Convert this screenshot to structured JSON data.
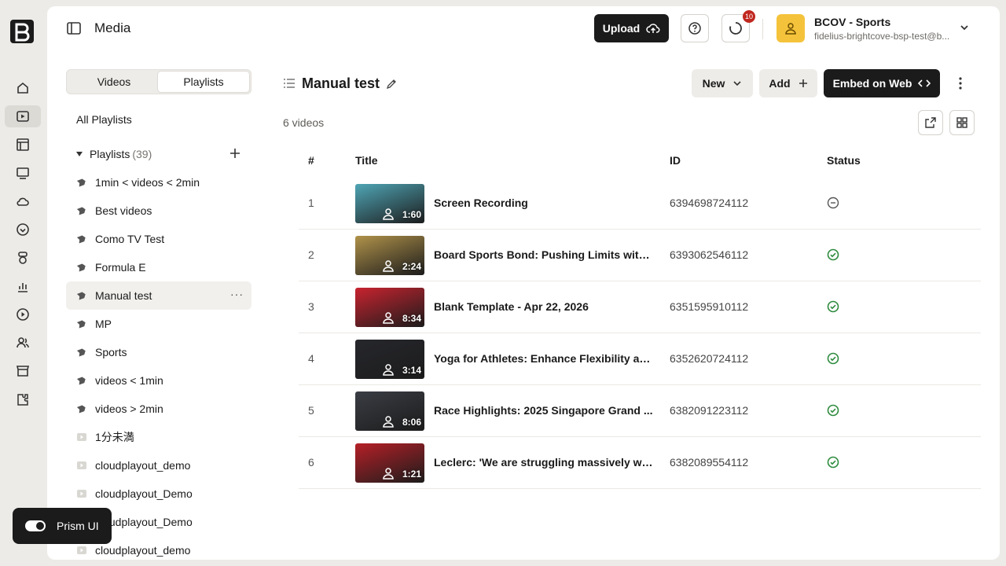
{
  "header": {
    "page_title": "Media",
    "upload_label": "Upload",
    "notification_count": "10",
    "account_name": "BCOV - Sports",
    "account_email": "fidelius-brightcove-bsp-test@b..."
  },
  "sidebar": {
    "tabs": [
      "Videos",
      "Playlists"
    ],
    "active_tab": "Playlists",
    "all_playlists": "All Playlists",
    "section_label": "Playlists",
    "section_count": "(39)",
    "items": [
      {
        "label": "1min < videos < 2min",
        "kind": "smart"
      },
      {
        "label": "Best videos",
        "kind": "smart"
      },
      {
        "label": "Como TV Test",
        "kind": "smart"
      },
      {
        "label": "Formula E",
        "kind": "smart"
      },
      {
        "label": "Manual test",
        "kind": "smart"
      },
      {
        "label": "MP",
        "kind": "smart"
      },
      {
        "label": "Sports",
        "kind": "smart"
      },
      {
        "label": "videos < 1min",
        "kind": "smart"
      },
      {
        "label": "videos > 2min",
        "kind": "smart"
      },
      {
        "label": "1分未満",
        "kind": "manual"
      },
      {
        "label": "cloudplayout_demo",
        "kind": "manual"
      },
      {
        "label": "cloudplayout_Demo",
        "kind": "manual"
      },
      {
        "label": "cloudplayout_Demo",
        "kind": "manual"
      },
      {
        "label": "cloudplayout_demo",
        "kind": "manual"
      }
    ],
    "selected_item": "Manual test",
    "more_glyph": "···"
  },
  "prism": {
    "label": "Prism UI",
    "enabled": true
  },
  "content": {
    "playlist_title": "Manual test",
    "video_count": "6 videos",
    "new_label": "New",
    "add_label": "Add",
    "embed_label": "Embed on Web",
    "columns": {
      "num": "#",
      "title": "Title",
      "id": "ID",
      "status": "Status"
    },
    "rows": [
      {
        "num": "1",
        "title": "Screen Recording",
        "id": "6394698724112",
        "duration": "1:60",
        "status": "inactive",
        "thumb": "#4fa5b5"
      },
      {
        "num": "2",
        "title": "Board Sports Bond: Pushing Limits with ...",
        "id": "6393062546112",
        "duration": "2:24",
        "status": "active",
        "thumb": "#b0924a"
      },
      {
        "num": "3",
        "title": "Blank Template - Apr 22, 2026",
        "id": "6351595910112",
        "duration": "8:34",
        "status": "active",
        "thumb": "#c8232f"
      },
      {
        "num": "4",
        "title": "Yoga for Athletes: Enhance Flexibility an...",
        "id": "6352620724112",
        "duration": "3:14",
        "status": "active",
        "thumb": "#26272c"
      },
      {
        "num": "5",
        "title": "Race Highlights: 2025 Singapore Grand ...",
        "id": "6382091223112",
        "duration": "8:06",
        "status": "active",
        "thumb": "#3a3d44"
      },
      {
        "num": "6",
        "title": "Leclerc: 'We are struggling massively wit...",
        "id": "6382089554112",
        "duration": "1:21",
        "status": "active",
        "thumb": "#b52027"
      }
    ]
  },
  "colors": {
    "status_active": "#2e8b3e",
    "status_inactive": "#555555",
    "accent_dark": "#1b1b1b",
    "avatar": "#f5c33b"
  }
}
